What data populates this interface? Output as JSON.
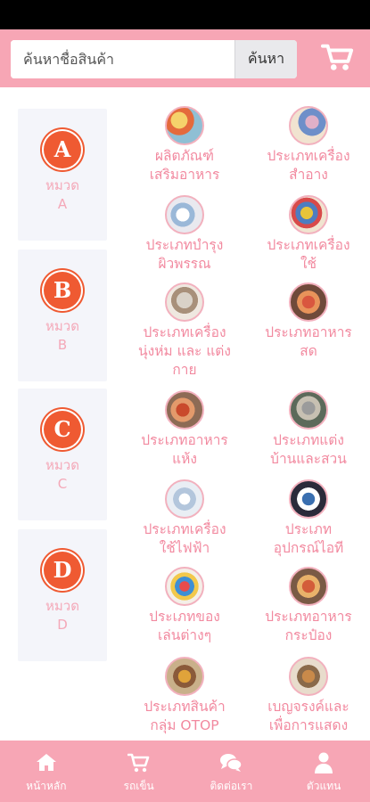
{
  "search": {
    "placeholder": "ค้นหาชื่อสินค้า",
    "button_label": "ค้นหา"
  },
  "categories": [
    {
      "letter": "A",
      "label": "หมวด",
      "code": "A"
    },
    {
      "letter": "B",
      "label": "หมวด",
      "code": "B"
    },
    {
      "letter": "C",
      "label": "หมวด",
      "code": "C"
    },
    {
      "letter": "D",
      "label": "หมวด",
      "code": "D"
    }
  ],
  "products": [
    {
      "line1": "ผลิตภัณฑ์",
      "line2": "เสริมอาหาร"
    },
    {
      "line1": "ประเภทเครื่อง",
      "line2": "สำอาง"
    },
    {
      "line1": "ประเภทบำรุง",
      "line2": "ผิวพรรณ"
    },
    {
      "line1": "ประเภทเครื่อง",
      "line2": "ใช้"
    },
    {
      "line1": "ประเภทเครื่อง",
      "line2": "นุ่งห่ม และ แต่ง",
      "line3": "กาย"
    },
    {
      "line1": "ประเภทอาหาร",
      "line2": "สด"
    },
    {
      "line1": "ประเภทอาหาร",
      "line2": "แห้ง"
    },
    {
      "line1": "ประเภทแต่ง",
      "line2": "บ้านและสวน"
    },
    {
      "line1": "ประเภทเครื่อง",
      "line2": "ใช้ไฟฟ้า"
    },
    {
      "line1": "ประเภท",
      "line2": "อุปกรณ์ไอที"
    },
    {
      "line1": "ประเภทของ",
      "line2": "เล่นต่างๆ"
    },
    {
      "line1": "ประเภทอาหาร",
      "line2": "กระป๋อง"
    },
    {
      "line1": "ประเภทสินค้า",
      "line2": "กลุ่ม OTOP"
    },
    {
      "line1": "เบญจรงค์และ",
      "line2": "เพื่อการแสดง"
    }
  ],
  "nav": {
    "home": "หน้าหลัก",
    "cart": "รถเข็น",
    "contact": "ติดต่อเรา",
    "agent": "ตัวแทน"
  },
  "colors": {
    "primary_pink": "#f7a6b5",
    "badge_orange": "#ef5a32",
    "text_pink": "#f28aa0"
  }
}
